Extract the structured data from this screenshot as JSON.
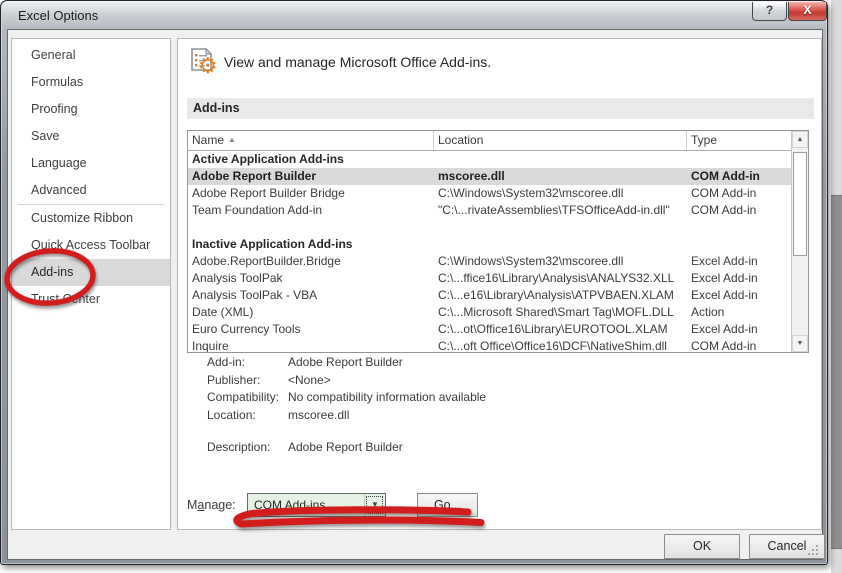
{
  "window": {
    "title": "Excel Options",
    "help_glyph": "?",
    "close_glyph": "X"
  },
  "sidebar": {
    "items": [
      {
        "label": "General",
        "selected": false
      },
      {
        "label": "Formulas",
        "selected": false
      },
      {
        "label": "Proofing",
        "selected": false
      },
      {
        "label": "Save",
        "selected": false
      },
      {
        "label": "Language",
        "selected": false
      },
      {
        "label": "Advanced",
        "selected": false,
        "divider_after": true
      },
      {
        "label": "Customize Ribbon",
        "selected": false
      },
      {
        "label": "Quick Access Toolbar",
        "selected": false
      },
      {
        "label": "Add-ins",
        "selected": true
      },
      {
        "label": "Trust Center",
        "selected": false
      }
    ]
  },
  "main": {
    "heading": "View and manage Microsoft Office Add-ins.",
    "section_title": "Add-ins",
    "table": {
      "columns": [
        "Name",
        "Location",
        "Type"
      ],
      "sort_indicator": "▲",
      "scroll_up_glyph": "▲",
      "scroll_down_glyph": "▼",
      "rows": [
        {
          "kind": "group",
          "name": "Active Application Add-ins"
        },
        {
          "kind": "item",
          "selected": true,
          "name": "Adobe Report Builder",
          "location": "mscoree.dll",
          "addin_type": "COM Add-in"
        },
        {
          "kind": "item",
          "name": "Adobe Report Builder Bridge",
          "location": "C:\\Windows\\System32\\mscoree.dll",
          "addin_type": "COM Add-in"
        },
        {
          "kind": "item",
          "name": "Team Foundation Add-in",
          "location": "\"C:\\...rivateAssemblies\\TFSOfficeAdd-in.dll\"",
          "addin_type": "COM Add-in"
        },
        {
          "kind": "blank"
        },
        {
          "kind": "group",
          "name": "Inactive Application Add-ins"
        },
        {
          "kind": "item",
          "name": "Adobe.ReportBuilder.Bridge",
          "location": "C:\\Windows\\System32\\mscoree.dll",
          "addin_type": "Excel Add-in"
        },
        {
          "kind": "item",
          "name": "Analysis ToolPak",
          "location": "C:\\...ffice16\\Library\\Analysis\\ANALYS32.XLL",
          "addin_type": "Excel Add-in"
        },
        {
          "kind": "item",
          "name": "Analysis ToolPak - VBA",
          "location": "C:\\...e16\\Library\\Analysis\\ATPVBAEN.XLAM",
          "addin_type": "Excel Add-in"
        },
        {
          "kind": "item",
          "name": "Date (XML)",
          "location": "C:\\...Microsoft Shared\\Smart Tag\\MOFL.DLL",
          "addin_type": "Action"
        },
        {
          "kind": "item",
          "name": "Euro Currency Tools",
          "location": "C:\\...ot\\Office16\\Library\\EUROTOOL.XLAM",
          "addin_type": "Excel Add-in"
        },
        {
          "kind": "item",
          "name": "Inquire",
          "location": "C:\\...oft Office\\Office16\\DCF\\NativeShim.dll",
          "addin_type": "COM Add-in"
        }
      ]
    },
    "details": {
      "rows": [
        {
          "label": "Add-in:",
          "value": "Adobe Report Builder"
        },
        {
          "label": "Publisher:",
          "value": "<None>"
        },
        {
          "label": "Compatibility:",
          "value": "No compatibility information available"
        },
        {
          "label": "Location:",
          "value": "mscoree.dll"
        },
        {
          "label": "Description:",
          "value": "Adobe Report Builder",
          "gap_before": true
        }
      ]
    },
    "manage": {
      "label_pre": "M",
      "label_accel": "a",
      "label_post": "nage:",
      "value": "COM Add-ins",
      "dropdown_glyph": "▼",
      "go_label": "Go..."
    }
  },
  "footer": {
    "ok_label": "OK",
    "cancel_label": "Cancel"
  },
  "annotations": {
    "color": "#d31d1d",
    "circled_item": "Add-ins",
    "underlined_controls": "Manage dropdown and Go button"
  }
}
